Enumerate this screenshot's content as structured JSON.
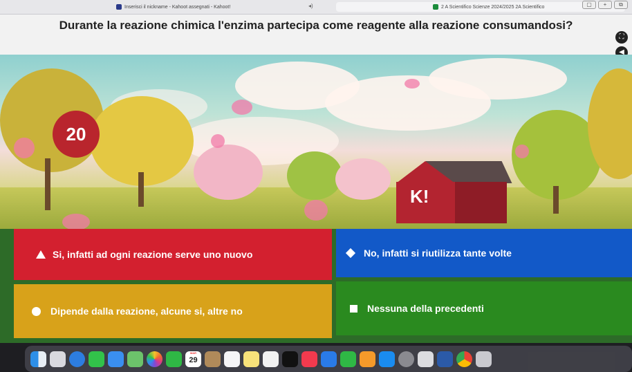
{
  "browser": {
    "tab1_title": "Inserisci il nickname - Kahoot assegnati - Kahoot!",
    "tab2_title": "2 A Scientifico Scienze 2024/2025 2A Scientifico"
  },
  "question": {
    "text": "Durante la reazione chimica l'enzima partecipa come reagente alla reazione consumandosi?"
  },
  "timer": {
    "value": "20"
  },
  "scene": {
    "barn_text": "K!"
  },
  "answers": [
    {
      "shape": "triangle",
      "color": "#d3202f",
      "label": "Si, infatti ad ogni reazione serve uno nuovo"
    },
    {
      "shape": "diamond",
      "color": "#1259c8",
      "label": "No, infatti si riutilizza tante volte"
    },
    {
      "shape": "circle",
      "color": "#d8a21a",
      "label": "Dipende dalla reazione, alcune si, altre no"
    },
    {
      "shape": "square",
      "color": "#2a8a1f",
      "label": "Nessuna della precedenti"
    }
  ],
  "dock": {
    "calendar_month": "MAR",
    "calendar_day": "29",
    "app_icons": [
      "finder-icon",
      "launchpad-icon",
      "safari-icon",
      "messages-icon",
      "mail-icon",
      "maps-icon",
      "photos-icon",
      "facetime-icon",
      "calendar-icon",
      "contacts-icon",
      "reminders-icon",
      "notes-icon",
      "freeform-icon",
      "tv-icon",
      "music-icon",
      "keynote-icon",
      "numbers-icon",
      "pages-icon",
      "app-store-icon",
      "system-settings-icon",
      "preview-icon",
      "word-icon",
      "chrome-icon",
      "trash-icon"
    ]
  }
}
